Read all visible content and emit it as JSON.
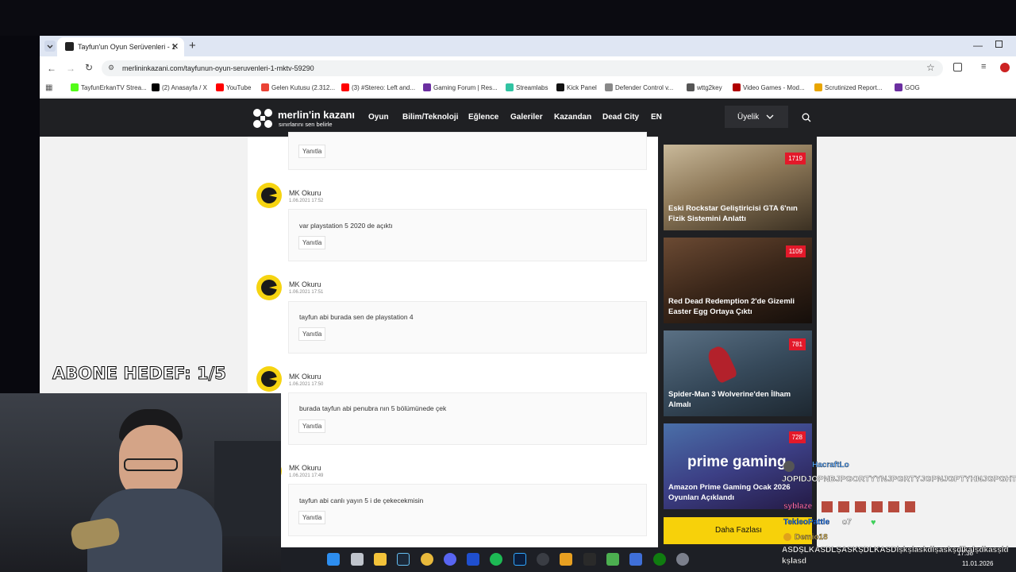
{
  "browser": {
    "tab_title": "Tayfun'un Oyun Serüvenleri - 1",
    "url": "merlininkazani.com/tayfunun-oyun-seruvenleri-1-mktv-59290",
    "bookmarks": [
      {
        "label": "TayfunErkanTV Strea...",
        "color": "#53fc18"
      },
      {
        "label": "(2) Anasayfa / X",
        "color": "#000000"
      },
      {
        "label": "YouTube",
        "color": "#ff0000"
      },
      {
        "label": "Gelen Kutusu (2.312...",
        "color": "#ea4335"
      },
      {
        "label": "(3) #Stereo: Left and...",
        "color": "#ff0000"
      },
      {
        "label": "Gaming Forum | Res...",
        "color": "#6b2fa0"
      },
      {
        "label": "Streamlabs",
        "color": "#31c3a2"
      },
      {
        "label": "Kick Panel",
        "color": "#111111"
      },
      {
        "label": "Defender Control v...",
        "color": "#888888"
      },
      {
        "label": "wttg2key",
        "color": "#555555"
      },
      {
        "label": "Video Games - Mod...",
        "color": "#b00000"
      },
      {
        "label": "Scrutinized Report...",
        "color": "#e8a500"
      },
      {
        "label": "GOG",
        "color": "#6b2fa0"
      }
    ]
  },
  "site": {
    "logo_main": "merlin'in kazanı",
    "logo_sub": "sınırlarını sen belirle",
    "nav": [
      "Oyun",
      "Bilim/Teknoloji",
      "Eğlence",
      "Galeriler",
      "Kazandan",
      "Dead City",
      "EN"
    ],
    "member_label": "Üyelik"
  },
  "comments": [
    {
      "name": "MK Okuru",
      "date": "1.06.2021 17:52",
      "text": "var playstation 5 2020 de açıktı",
      "reply": "Yanıtla"
    },
    {
      "name": "MK Okuru",
      "date": "1.06.2021 17:51",
      "text": "tayfun abi burada sen de playstation 4",
      "reply": "Yanıtla"
    },
    {
      "name": "MK Okuru",
      "date": "1.06.2021 17:50",
      "text": "burada tayfun abi penubra nın 5 bölümünede çek",
      "reply": "Yanıtla"
    },
    {
      "name": "MK Okuru",
      "date": "1.06.2021 17:49",
      "text": "tayfun abi canlı yayın 5 i de çekecekmisin",
      "reply": "Yanıtla"
    }
  ],
  "top_reply": "Yanıtla",
  "sidebar": {
    "cards": [
      {
        "count": "1719",
        "title": "Eski Rockstar Geliştiricisi GTA 6'nın Fizik Sistemini Anlattı"
      },
      {
        "count": "1109",
        "title": "Red Dead Redemption 2'de Gizemli Easter Egg Ortaya Çıktı"
      },
      {
        "count": "781",
        "title": "Spider-Man 3 Wolverine'den İlham Almalı"
      },
      {
        "count": "728",
        "title": "Amazon Prime Gaming Ocak 2026 Oyunları Açıklandı",
        "image_text": "prime gaming"
      }
    ],
    "more_label": "Daha Fazlası"
  },
  "overlay": {
    "abone_label": "ABONE HEDEF:",
    "abone_value": "1/5"
  },
  "chat": [
    {
      "user": "HacraftLo",
      "msg": "JOPIDJOPNBJPGORTYYNJPGRTYJGPNJGPTYHNJGPGHTN"
    },
    {
      "user": "syblaze",
      "msg": ""
    },
    {
      "user": "TekleoPattle",
      "msg": "o7"
    },
    {
      "user": "Demio18",
      "msg": "ASDŞLKASDLŞASKŞDLKASDlşkşlaskdlşaskşdlkalşdkasşld kşlasd"
    }
  ],
  "taskbar": {
    "time": "17:38",
    "date": "11.01.2026"
  }
}
